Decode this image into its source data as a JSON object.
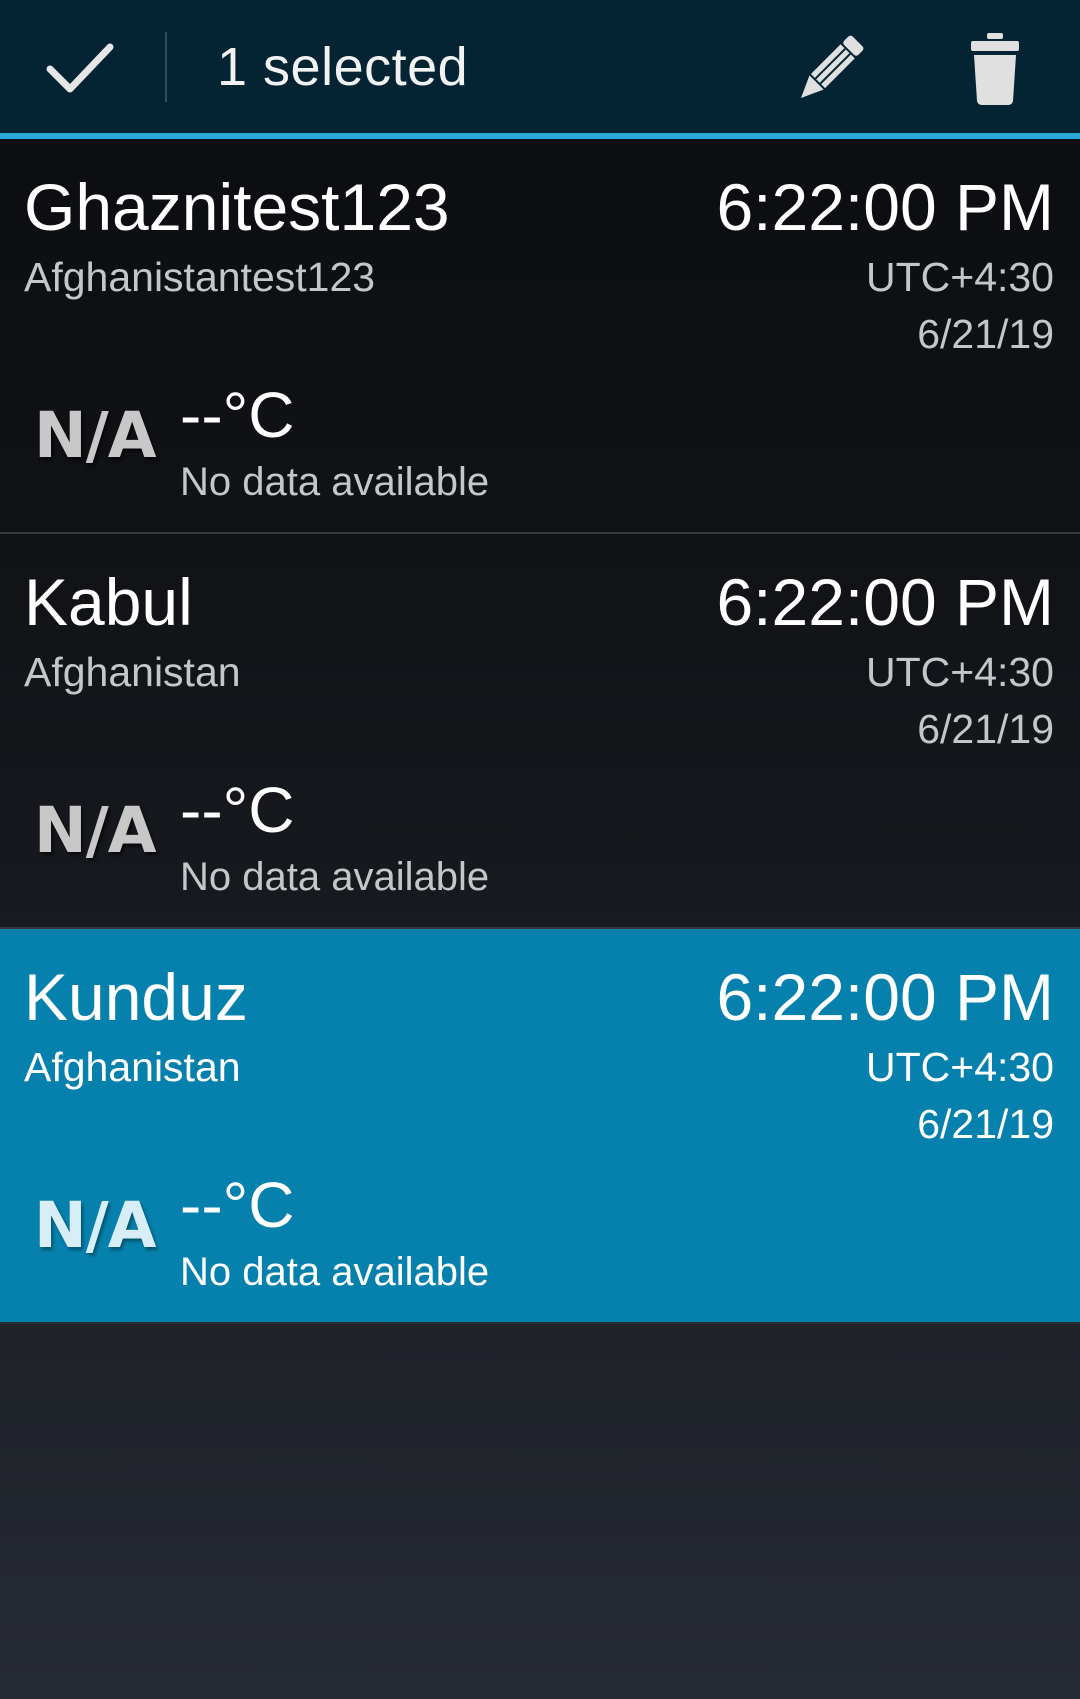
{
  "action_bar": {
    "selection_text": "1 selected",
    "done_icon": "checkmark-icon",
    "edit_icon": "pencil-icon",
    "delete_icon": "trash-icon",
    "background_color": "#042433",
    "accent_color": "#2aa8d8"
  },
  "cities": [
    {
      "name": "Ghaznitest123",
      "country": "Afghanistantest123",
      "time": "6:22:00 PM",
      "utc_offset": "UTC+4:30",
      "date": "6/21/19",
      "weather_icon": "N/A",
      "temperature": "--°C",
      "status": "No data available",
      "selected": false
    },
    {
      "name": "Kabul",
      "country": "Afghanistan",
      "time": "6:22:00 PM",
      "utc_offset": "UTC+4:30",
      "date": "6/21/19",
      "weather_icon": "N/A",
      "temperature": "--°C",
      "status": "No data available",
      "selected": false
    },
    {
      "name": "Kunduz",
      "country": "Afghanistan",
      "time": "6:22:00 PM",
      "utc_offset": "UTC+4:30",
      "date": "6/21/19",
      "weather_icon": "N/A",
      "temperature": "--°C",
      "status": "No data available",
      "selected": true
    }
  ],
  "colors": {
    "selected_row": "#0680ad"
  }
}
